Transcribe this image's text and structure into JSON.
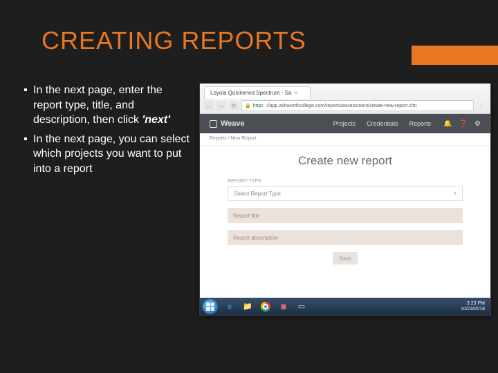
{
  "title": "CREATING REPORTS",
  "bullets": {
    "b1_pre": "In the next page, enter the report type, title, and description, then click ",
    "b1_bold": "'next'",
    "b2": "In the next page, you can select which projects you want to put into a report"
  },
  "screenshot": {
    "tab_title": "Loyola Quickened Spectrum - Sa",
    "url_prefix": "https",
    "url_rest": "://app.ashworthcollege.com/reports/assessment/create-new-report.cfm",
    "appbar": {
      "brand": "Weave",
      "nav": {
        "projects": "Projects",
        "credentials": "Credentials",
        "reports": "Reports"
      }
    },
    "breadcrumb": "Reports / New Report",
    "heading": "Create new report",
    "form": {
      "section_label": "REPORT TYPE",
      "select_placeholder": "Select Report Type",
      "title_placeholder": "Report title",
      "desc_placeholder": "Report description",
      "next_label": "Next"
    },
    "taskbar": {
      "time": "3:23 PM",
      "date": "10/23/2018"
    }
  }
}
